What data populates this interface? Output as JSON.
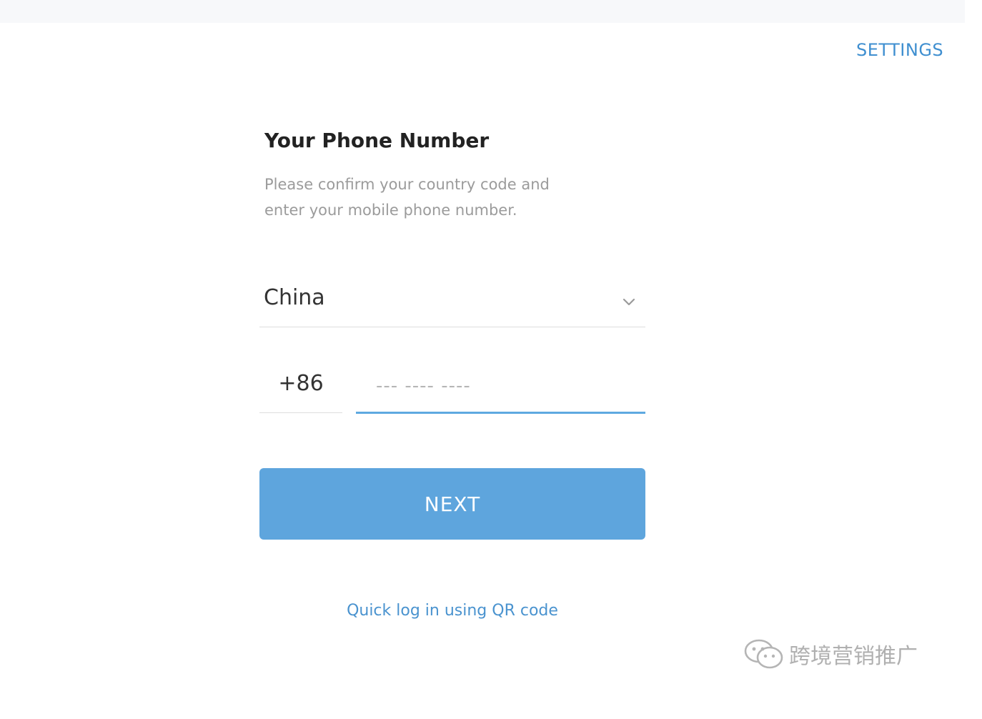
{
  "header": {
    "settings_label": "SETTINGS"
  },
  "form": {
    "title": "Your Phone Number",
    "subtitle": "Please confirm your country code and enter your mobile phone number.",
    "country": {
      "selected": "China"
    },
    "country_code": "+86",
    "phone": {
      "value": "",
      "placeholder": "--- ---- ----"
    },
    "next_label": "NEXT",
    "qr_link_label": "Quick log in using QR code"
  },
  "watermark": {
    "text": "跨境营销推广"
  },
  "colors": {
    "accent": "#5ea5dd",
    "link": "#4a93cf",
    "title": "#222222",
    "subtitle": "#9b9b9b"
  },
  "icons": {
    "country_dropdown": "chevron-down-icon",
    "watermark_logo": "wechat-icon"
  }
}
